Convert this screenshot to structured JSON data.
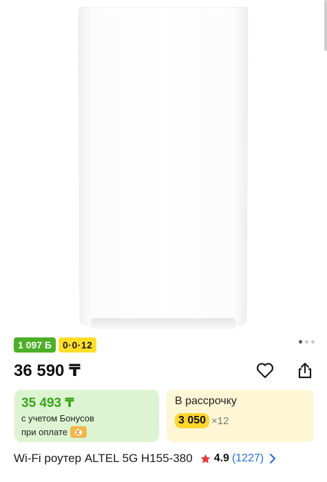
{
  "product": {
    "title": "Wi-Fi роутер ALTEL 5G H155-380",
    "image_alt": "ALTEL 5G H155-380 router",
    "gallery_active_index": 0,
    "gallery_count": 3
  },
  "tags": {
    "bonus": "1 097 Б",
    "installment_plan": "0·0·12"
  },
  "price": {
    "value": "36 590 ₸"
  },
  "actions": {
    "favorite_icon": "heart-icon",
    "share_icon": "share-icon"
  },
  "bonus_card": {
    "price": "35 493 ₸",
    "line1": "с учетом Бонусов",
    "line2": "при оплате",
    "badge_icon": "kaspi-icon",
    "bg_color": "#ddf4d2",
    "accent_color": "#3aa61a"
  },
  "installment_card": {
    "label": "В рассрочку",
    "monthly": "3 050",
    "months": "×12",
    "bg_color": "#fff6d6",
    "accent_color": "#ffd530"
  },
  "rating": {
    "value": "4.9",
    "reviews": "(1227)",
    "star_color": "#e53935",
    "link_color": "#1f73d6"
  }
}
